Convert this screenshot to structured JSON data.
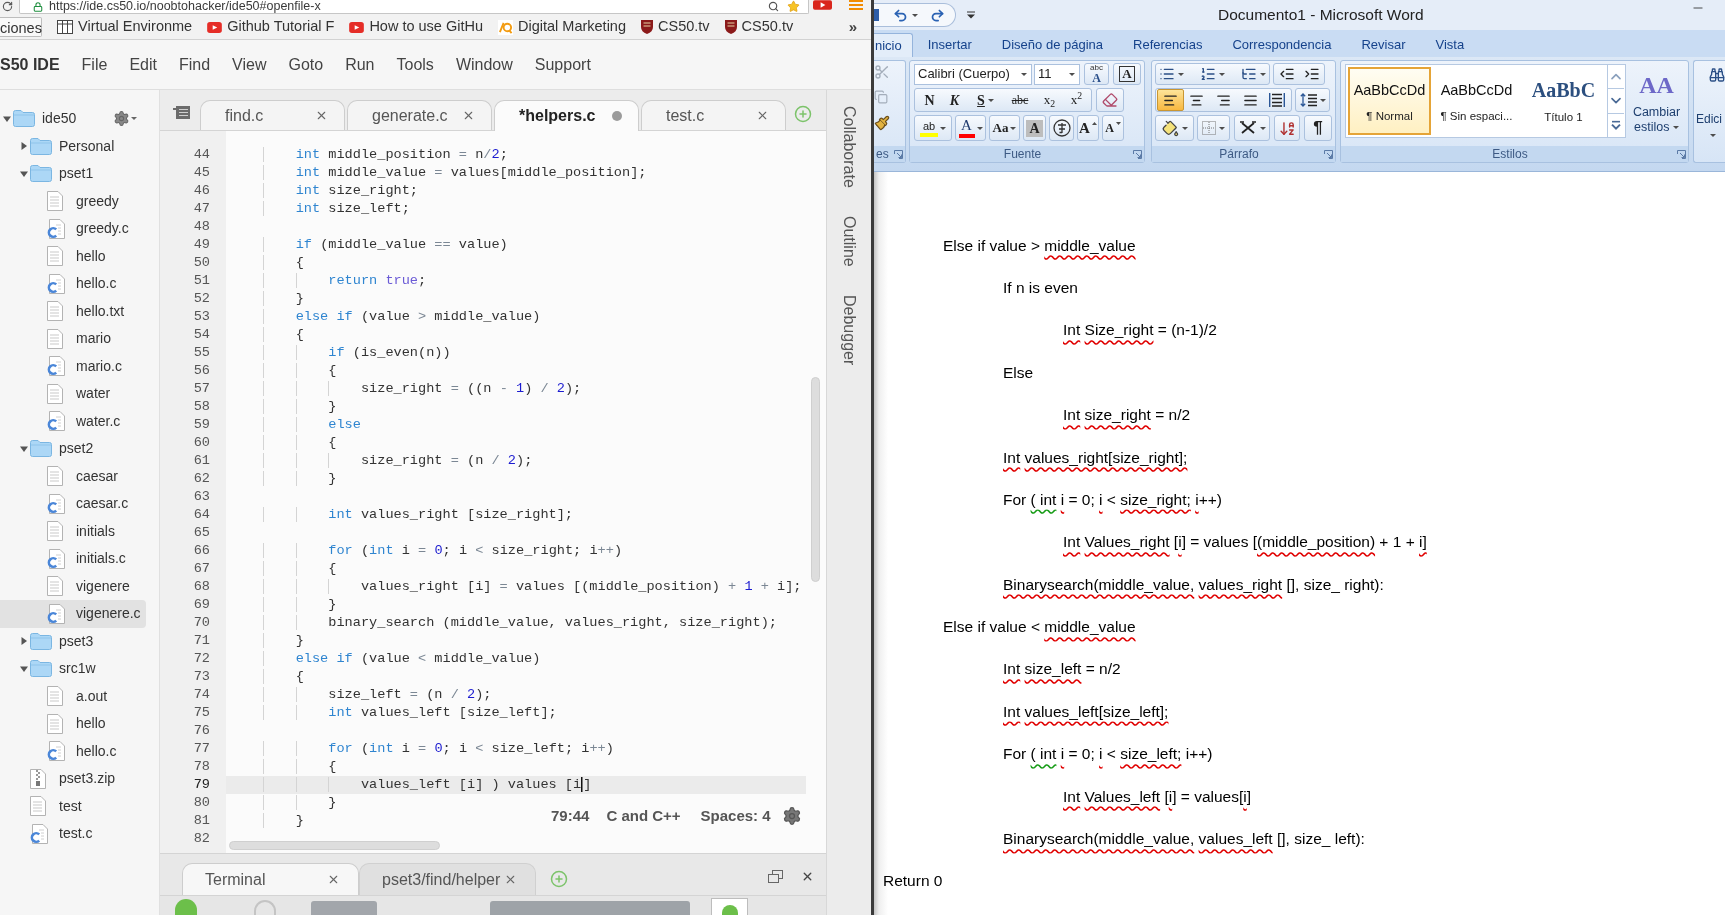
{
  "browser": {
    "url": "https://ide.cs50.io/noobtohacker/ide50#openfile-x",
    "bookmarks": [
      {
        "label": "ciones",
        "kind": "apps"
      },
      {
        "label": "Virtual Environme",
        "kind": "page"
      },
      {
        "label": "Github Tutorial F",
        "kind": "video"
      },
      {
        "label": "How to use GitHu",
        "kind": "video"
      },
      {
        "label": "Digital Marketing",
        "kind": "site"
      },
      {
        "label": "CS50.tv",
        "kind": "shield"
      },
      {
        "label": "CS50.tv",
        "kind": "shield"
      }
    ],
    "overflow": "»"
  },
  "ide": {
    "brand": "S50 IDE",
    "menu": [
      "File",
      "Edit",
      "Find",
      "View",
      "Goto",
      "Run",
      "Tools",
      "Window",
      "Support"
    ],
    "tree": [
      {
        "name": "ide50",
        "kind": "folder",
        "expanded": true,
        "selected": false,
        "children": [
          {
            "name": "Personal",
            "kind": "folder",
            "expanded": false,
            "selected": false
          },
          {
            "name": "pset1",
            "kind": "folder",
            "expanded": true,
            "selected": false,
            "children": [
              {
                "name": "greedy",
                "kind": "file",
                "selected": false
              },
              {
                "name": "greedy.c",
                "kind": "source",
                "selected": false
              },
              {
                "name": "hello",
                "kind": "file",
                "selected": false
              },
              {
                "name": "hello.c",
                "kind": "source",
                "selected": false
              },
              {
                "name": "hello.txt",
                "kind": "file",
                "selected": false
              },
              {
                "name": "mario",
                "kind": "file",
                "selected": false
              },
              {
                "name": "mario.c",
                "kind": "source",
                "selected": false
              },
              {
                "name": "water",
                "kind": "file",
                "selected": false
              },
              {
                "name": "water.c",
                "kind": "source",
                "selected": false
              }
            ]
          },
          {
            "name": "pset2",
            "kind": "folder",
            "expanded": true,
            "selected": false,
            "children": [
              {
                "name": "caesar",
                "kind": "file",
                "selected": false
              },
              {
                "name": "caesar.c",
                "kind": "source",
                "selected": false
              },
              {
                "name": "initials",
                "kind": "file",
                "selected": false
              },
              {
                "name": "initials.c",
                "kind": "source",
                "selected": false
              },
              {
                "name": "vigenere",
                "kind": "file",
                "selected": false
              },
              {
                "name": "vigenere.c",
                "kind": "source",
                "selected": true
              }
            ]
          },
          {
            "name": "pset3",
            "kind": "folder",
            "expanded": false,
            "selected": false
          },
          {
            "name": "src1w",
            "kind": "folder",
            "expanded": true,
            "selected": false,
            "children": [
              {
                "name": "a.out",
                "kind": "file",
                "selected": false
              },
              {
                "name": "hello",
                "kind": "file",
                "selected": false
              },
              {
                "name": "hello.c",
                "kind": "source",
                "selected": false
              }
            ]
          },
          {
            "name": "pset3.zip",
            "kind": "archive",
            "selected": false
          },
          {
            "name": "test",
            "kind": "file",
            "selected": false
          },
          {
            "name": "test.c",
            "kind": "source",
            "selected": false
          }
        ]
      }
    ],
    "tabs": [
      {
        "label": "find.c",
        "selected": false,
        "modified": false
      },
      {
        "label": "generate.c",
        "selected": false,
        "modified": false
      },
      {
        "label": "*helpers.c",
        "selected": true,
        "modified": true
      },
      {
        "label": "test.c",
        "selected": false,
        "modified": false
      }
    ],
    "code": [
      {
        "number": "44",
        "current": false,
        "tokens": [
          {
            "text": "    int",
            "kind": "keyword"
          },
          " middle_position ",
          {
            "text": "=",
            "kind": "operator"
          },
          " n",
          {
            "text": "/",
            "kind": "operator"
          },
          {
            "text": "2",
            "kind": "number"
          },
          ";"
        ]
      },
      {
        "number": "45",
        "current": false,
        "tokens": [
          {
            "text": "    int",
            "kind": "keyword"
          },
          " middle_value ",
          {
            "text": "=",
            "kind": "operator"
          },
          " values[middle_position];"
        ]
      },
      {
        "number": "46",
        "current": false,
        "tokens": [
          {
            "text": "    int",
            "kind": "keyword"
          },
          " size_right;"
        ]
      },
      {
        "number": "47",
        "current": false,
        "tokens": [
          {
            "text": "    int",
            "kind": "keyword"
          },
          " size_left;"
        ]
      },
      {
        "number": "48",
        "current": false
      },
      {
        "number": "49",
        "current": false,
        "tokens": [
          {
            "text": "    if",
            "kind": "keyword"
          },
          " (middle_value ",
          {
            "text": "==",
            "kind": "operator"
          },
          " value)"
        ]
      },
      {
        "number": "50",
        "current": false,
        "tokens": [
          "    {"
        ]
      },
      {
        "number": "51",
        "current": false,
        "tokens": [
          {
            "text": "        return",
            "kind": "keyword"
          },
          {
            "text": " true",
            "kind": "constant"
          },
          ";"
        ]
      },
      {
        "number": "52",
        "current": false,
        "tokens": [
          "    }"
        ]
      },
      {
        "number": "53",
        "current": false,
        "tokens": [
          {
            "text": "    else",
            "kind": "keyword"
          },
          {
            "text": " if",
            "kind": "keyword"
          },
          " (value ",
          {
            "text": ">",
            "kind": "operator"
          },
          " middle_value)"
        ]
      },
      {
        "number": "54",
        "current": false,
        "tokens": [
          "    {"
        ]
      },
      {
        "number": "55",
        "current": false,
        "tokens": [
          {
            "text": "        if",
            "kind": "keyword"
          },
          " (is_even(n))"
        ]
      },
      {
        "number": "56",
        "current": false,
        "tokens": [
          "        {"
        ]
      },
      {
        "number": "57",
        "current": false,
        "tokens": [
          "            size_right ",
          {
            "text": "=",
            "kind": "operator"
          },
          " ((n ",
          {
            "text": "-",
            "kind": "operator"
          },
          {
            "text": " 1",
            "kind": "number"
          },
          ") ",
          {
            "text": "/",
            "kind": "operator"
          },
          {
            "text": " 2",
            "kind": "number"
          },
          ");"
        ]
      },
      {
        "number": "58",
        "current": false,
        "tokens": [
          "        }"
        ]
      },
      {
        "number": "59",
        "current": false,
        "tokens": [
          {
            "text": "        else",
            "kind": "keyword"
          }
        ]
      },
      {
        "number": "60",
        "current": false,
        "tokens": [
          "        {"
        ]
      },
      {
        "number": "61",
        "current": false,
        "tokens": [
          "            size_right ",
          {
            "text": "=",
            "kind": "operator"
          },
          " (n ",
          {
            "text": "/",
            "kind": "operator"
          },
          {
            "text": " 2",
            "kind": "number"
          },
          ");"
        ]
      },
      {
        "number": "62",
        "current": false,
        "tokens": [
          "        }"
        ]
      },
      {
        "number": "63",
        "current": false
      },
      {
        "number": "64",
        "current": false,
        "tokens": [
          {
            "text": "        int",
            "kind": "keyword"
          },
          " values_right [size_right];"
        ]
      },
      {
        "number": "65",
        "current": false
      },
      {
        "number": "66",
        "current": false,
        "tokens": [
          {
            "text": "        for",
            "kind": "keyword"
          },
          " (",
          {
            "text": "int",
            "kind": "keyword"
          },
          " i ",
          {
            "text": "=",
            "kind": "operator"
          },
          {
            "text": " 0",
            "kind": "number"
          },
          "; i ",
          {
            "text": "<",
            "kind": "operator"
          },
          " size_right; i",
          {
            "text": "++",
            "kind": "operator"
          },
          ")"
        ]
      },
      {
        "number": "67",
        "current": false,
        "tokens": [
          "        {"
        ]
      },
      {
        "number": "68",
        "current": false,
        "tokens": [
          "            values_right [i] ",
          {
            "text": "=",
            "kind": "operator"
          },
          " values [(middle_position) ",
          {
            "text": "+",
            "kind": "operator"
          },
          {
            "text": " 1",
            "kind": "number"
          },
          {
            "text": " +",
            "kind": "operator"
          },
          " i];"
        ]
      },
      {
        "number": "69",
        "current": false,
        "tokens": [
          "        }"
        ]
      },
      {
        "number": "70",
        "current": false,
        "tokens": [
          "        binary_search (middle_value, values_right, size_right);"
        ]
      },
      {
        "number": "71",
        "current": false,
        "tokens": [
          "    }"
        ]
      },
      {
        "number": "72",
        "current": false,
        "tokens": [
          {
            "text": "    else",
            "kind": "keyword"
          },
          {
            "text": " if",
            "kind": "keyword"
          },
          " (value ",
          {
            "text": "<",
            "kind": "operator"
          },
          " middle_value)"
        ]
      },
      {
        "number": "73",
        "current": false,
        "tokens": [
          "    {"
        ]
      },
      {
        "number": "74",
        "current": false,
        "tokens": [
          "        size_left ",
          {
            "text": "=",
            "kind": "operator"
          },
          " (n ",
          {
            "text": "/",
            "kind": "operator"
          },
          {
            "text": " 2",
            "kind": "number"
          },
          ");"
        ]
      },
      {
        "number": "75",
        "current": false,
        "tokens": [
          {
            "text": "        int",
            "kind": "keyword"
          },
          " values_left [size_left];"
        ]
      },
      {
        "number": "76",
        "current": false
      },
      {
        "number": "77",
        "current": false,
        "tokens": [
          {
            "text": "        for",
            "kind": "keyword"
          },
          " (",
          {
            "text": "int",
            "kind": "keyword"
          },
          " i ",
          {
            "text": "=",
            "kind": "operator"
          },
          {
            "text": " 0",
            "kind": "number"
          },
          "; i ",
          {
            "text": "<",
            "kind": "operator"
          },
          " size_left; i",
          {
            "text": "++",
            "kind": "operator"
          },
          ")"
        ]
      },
      {
        "number": "78",
        "current": false,
        "tokens": [
          "        {"
        ]
      },
      {
        "number": "79",
        "current": true,
        "tokens": [
          "            values_left [i] ) values [i",
          {
            "text": "]",
            "kind": "after_caret"
          }
        ]
      },
      {
        "number": "80",
        "current": false,
        "tokens": [
          "        }"
        ]
      },
      {
        "number": "81",
        "current": false,
        "tokens": [
          "    }"
        ]
      },
      {
        "number": "82",
        "current": false
      }
    ],
    "status": {
      "position": "79:44",
      "language": "C and C++",
      "indentation": "Spaces: 4"
    },
    "side_panels": [
      "Collaborate",
      "Outline",
      "Debugger"
    ],
    "console_tabs": [
      {
        "label": "Terminal",
        "selected": true
      },
      {
        "label": "pset3/find/helper",
        "selected": false
      }
    ]
  },
  "word": {
    "title": "Documento1 - Microsoft Word",
    "tabs": [
      {
        "label": "nicio",
        "selected": true
      },
      {
        "label": "Insertar",
        "selected": false
      },
      {
        "label": "Diseño de página",
        "selected": false
      },
      {
        "label": "Referencias",
        "selected": false
      },
      {
        "label": "Correspondencia",
        "selected": false
      },
      {
        "label": "Revisar",
        "selected": false
      },
      {
        "label": "Vista",
        "selected": false
      }
    ],
    "clipboard": {
      "label": "es",
      "tools": [
        {
          "kind": "cut",
          "disabled": true
        },
        {
          "kind": "copy",
          "disabled": true
        },
        {
          "kind": "format_painter",
          "disabled": false
        }
      ]
    },
    "font": {
      "family": "Calibri (Cuerpo)",
      "size": "11",
      "phonetic": {
        "top": "abc",
        "base": "A"
      },
      "border_sample": "A",
      "styles": [
        {
          "label": "N",
          "kind": "bold"
        },
        {
          "label": "K",
          "kind": "italic"
        },
        {
          "label": "S",
          "kind": "underline"
        },
        {
          "label": "abc",
          "kind": "strike"
        },
        {
          "label": "x$_{2}$",
          "kind": "script"
        },
        {
          "label": "x$^{2}$",
          "kind": "script"
        }
      ],
      "effects": [
        {
          "label": "ab",
          "kind": "highlight",
          "color": "#ffff00"
        },
        {
          "label": "A",
          "kind": "color",
          "color": "#ff0000"
        },
        {
          "label": "Aa",
          "kind": "case"
        },
        {
          "label": "A",
          "kind": "shade"
        },
        {
          "kind": "enclose"
        },
        {
          "label": "A",
          "kind": "grow"
        },
        {
          "label": "A",
          "kind": "shrink"
        }
      ],
      "label": "Fuente"
    },
    "paragraph": {
      "alignment": [
        {
          "kind": "left",
          "selected": true
        },
        {
          "kind": "center",
          "selected": false
        },
        {
          "kind": "right",
          "selected": false
        },
        {
          "kind": "justify",
          "selected": false
        },
        {
          "kind": "distribute",
          "selected": false
        }
      ],
      "mark": "¶",
      "label": "Párrafo"
    },
    "styles": {
      "gallery": [
        {
          "sample": "AaBbCcDd",
          "name": "¶ Normal",
          "kind": "body",
          "selected": true
        },
        {
          "sample": "AaBbCcDd",
          "name": "¶ Sin espaci...",
          "kind": "body",
          "selected": false
        },
        {
          "sample": "AaBbC",
          "name": "Título 1",
          "kind": "heading",
          "selected": false
        }
      ],
      "change": {
        "glyph": "AA",
        "label": "Cambiar estilos"
      },
      "label": "Estilos"
    },
    "editing": {
      "label": "Edici"
    },
    "document": {
      "blocks": [
        {
          "kind": "indented",
          "segments": [
            "Else if value > ",
            {
              "text": "middle_value",
              "kind": "misspelled"
            }
          ],
          "children": [
            {
              "segments": [
                "If n is even"
              ],
              "children": [
                {
                  "segments": [
                    {
                      "text": "Int",
                      "kind": "misspelled"
                    },
                    {
                      "text": " Size_right",
                      "kind": "misspelled"
                    },
                    " = (n-1)/2"
                  ]
                }
              ]
            },
            {
              "segments": [
                "Else"
              ],
              "children": [
                {
                  "segments": [
                    {
                      "text": "Int",
                      "kind": "misspelled"
                    },
                    {
                      "text": " size_right",
                      "kind": "misspelled"
                    },
                    " = n/2"
                  ]
                }
              ]
            },
            {
              "segments": [
                {
                  "text": "Int",
                  "kind": "misspelled"
                },
                {
                  "text": " values_right[size_right];",
                  "kind": "misspelled"
                }
              ]
            },
            {
              "segments": [
                "For ",
                {
                  "text": "( int",
                  "kind": "grammar"
                },
                {
                  "text": " i",
                  "kind": "misspelled"
                },
                " = 0; ",
                {
                  "text": "i",
                  "kind": "misspelled"
                },
                " < ",
                {
                  "text": "size_right;",
                  "kind": "misspelled"
                },
                {
                  "text": " i",
                  "kind": "misspelled"
                },
                "++)"
              ],
              "children": [
                {
                  "segments": [
                    {
                      "text": "Int",
                      "kind": "misspelled"
                    },
                    {
                      "text": " Values_right",
                      "kind": "misspelled"
                    },
                    " [",
                    {
                      "text": "i",
                      "kind": "misspelled"
                    },
                    "] = values [",
                    {
                      "text": "(middle_position)",
                      "kind": "misspelled"
                    },
                    " + 1 + ",
                    {
                      "text": "i]",
                      "kind": "misspelled"
                    }
                  ]
                }
              ]
            },
            {
              "segments": [
                {
                  "text": "Binarysearch(middle_value,",
                  "kind": "misspelled"
                },
                {
                  "text": " values_right",
                  "kind": "misspelled"
                },
                " [], size_ right):"
              ]
            }
          ]
        },
        {
          "kind": "indented",
          "segments": [
            "Else if value < ",
            {
              "text": "middle_value",
              "kind": "misspelled"
            }
          ],
          "children": [
            {
              "segments": [
                {
                  "text": "Int",
                  "kind": "misspelled"
                },
                {
                  "text": " size_left",
                  "kind": "misspelled"
                },
                " = n/2"
              ]
            },
            {
              "segments": [
                {
                  "text": "Int",
                  "kind": "misspelled"
                },
                {
                  "text": " values_left[size_left];",
                  "kind": "misspelled"
                }
              ]
            },
            {
              "segments": [
                "For ",
                {
                  "text": "( int",
                  "kind": "grammar"
                },
                {
                  "text": " i",
                  "kind": "misspelled"
                },
                " = 0; ",
                {
                  "text": "i",
                  "kind": "misspelled"
                },
                " < ",
                {
                  "text": "size_left;",
                  "kind": "misspelled"
                },
                " i++)"
              ],
              "children": [
                {
                  "segments": [
                    {
                      "text": "Int",
                      "kind": "misspelled"
                    },
                    {
                      "text": " Values_left",
                      "kind": "misspelled"
                    },
                    " [",
                    {
                      "text": "i",
                      "kind": "misspelled"
                    },
                    "] = values[",
                    {
                      "text": "i",
                      "kind": "misspelled"
                    },
                    "]"
                  ]
                }
              ]
            },
            {
              "segments": [
                {
                  "text": "Binarysearch(middle_value,",
                  "kind": "misspelled"
                },
                {
                  "text": " values_left",
                  "kind": "misspelled"
                },
                " [], size_ left):"
              ]
            }
          ]
        },
        {
          "kind": "flush",
          "segments": [
            "Return 0"
          ]
        }
      ]
    }
  }
}
